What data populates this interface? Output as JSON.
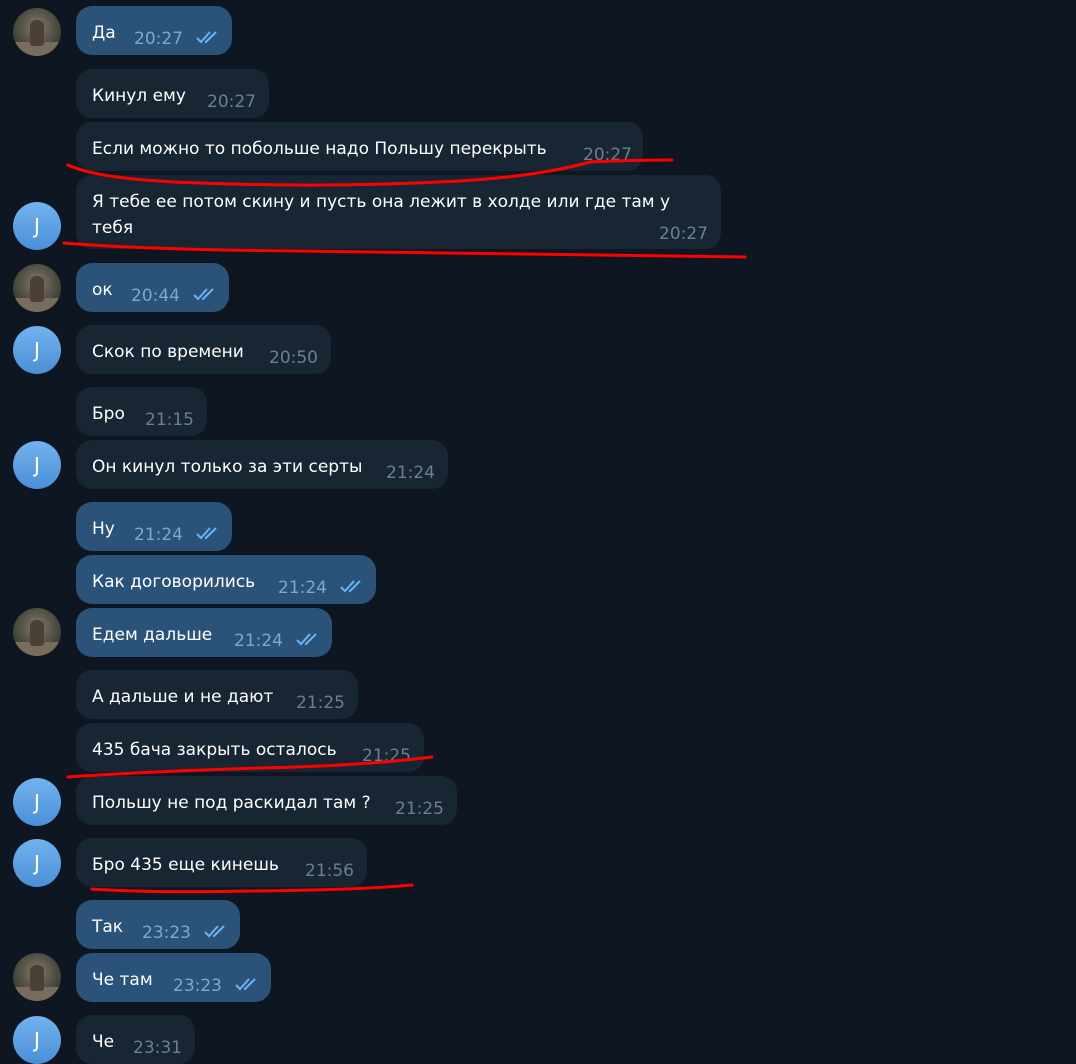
{
  "user_initial": "J",
  "messages": [
    {
      "text": "Да",
      "time": "20:27",
      "dir": "out",
      "read": true
    },
    {
      "text": "Кинул ему",
      "time": "20:27",
      "dir": "in",
      "read": false
    },
    {
      "text": "Если можно то побольше надо Польшу перекрыть",
      "time": "20:27",
      "dir": "in",
      "read": false
    },
    {
      "text": "Я тебе ее потом скину и пусть она лежит в холде или где там у тебя",
      "time": "20:27",
      "dir": "in",
      "read": false
    },
    {
      "text": "ок",
      "time": "20:44",
      "dir": "out",
      "read": true
    },
    {
      "text": "Скок по времени",
      "time": "20:50",
      "dir": "in",
      "read": false
    },
    {
      "text": "Бро",
      "time": "21:15",
      "dir": "in",
      "read": false
    },
    {
      "text": "Он кинул только за эти серты",
      "time": "21:24",
      "dir": "in",
      "read": false
    },
    {
      "text": "Ну",
      "time": "21:24",
      "dir": "out",
      "read": true
    },
    {
      "text": "Как договорились",
      "time": "21:24",
      "dir": "out",
      "read": true
    },
    {
      "text": "Едем дальше",
      "time": "21:24",
      "dir": "out",
      "read": true
    },
    {
      "text": "А дальше и не дают",
      "time": "21:25",
      "dir": "in",
      "read": false
    },
    {
      "text": "435 бача закрыть осталось",
      "time": "21:25",
      "dir": "in",
      "read": false
    },
    {
      "text": "Польшу не под раскидал там ?",
      "time": "21:25",
      "dir": "in",
      "read": false
    },
    {
      "text": "Бро 435 еще кинешь",
      "time": "21:56",
      "dir": "in",
      "read": false
    },
    {
      "text": "Так",
      "time": "23:23",
      "dir": "out",
      "read": true
    },
    {
      "text": "Че там",
      "time": "23:23",
      "dir": "out",
      "read": true
    },
    {
      "text": "Че",
      "time": "23:31",
      "dir": "in",
      "read": false
    }
  ],
  "colors": {
    "background": "#0e1621",
    "bubble_out": "#2b5278",
    "bubble_in": "#182533",
    "read_ticks": "#6ab3f3",
    "annotation": "#ff0000"
  },
  "icons": [
    "double-check-icon",
    "user-photo-avatar",
    "user-letter-avatar"
  ]
}
